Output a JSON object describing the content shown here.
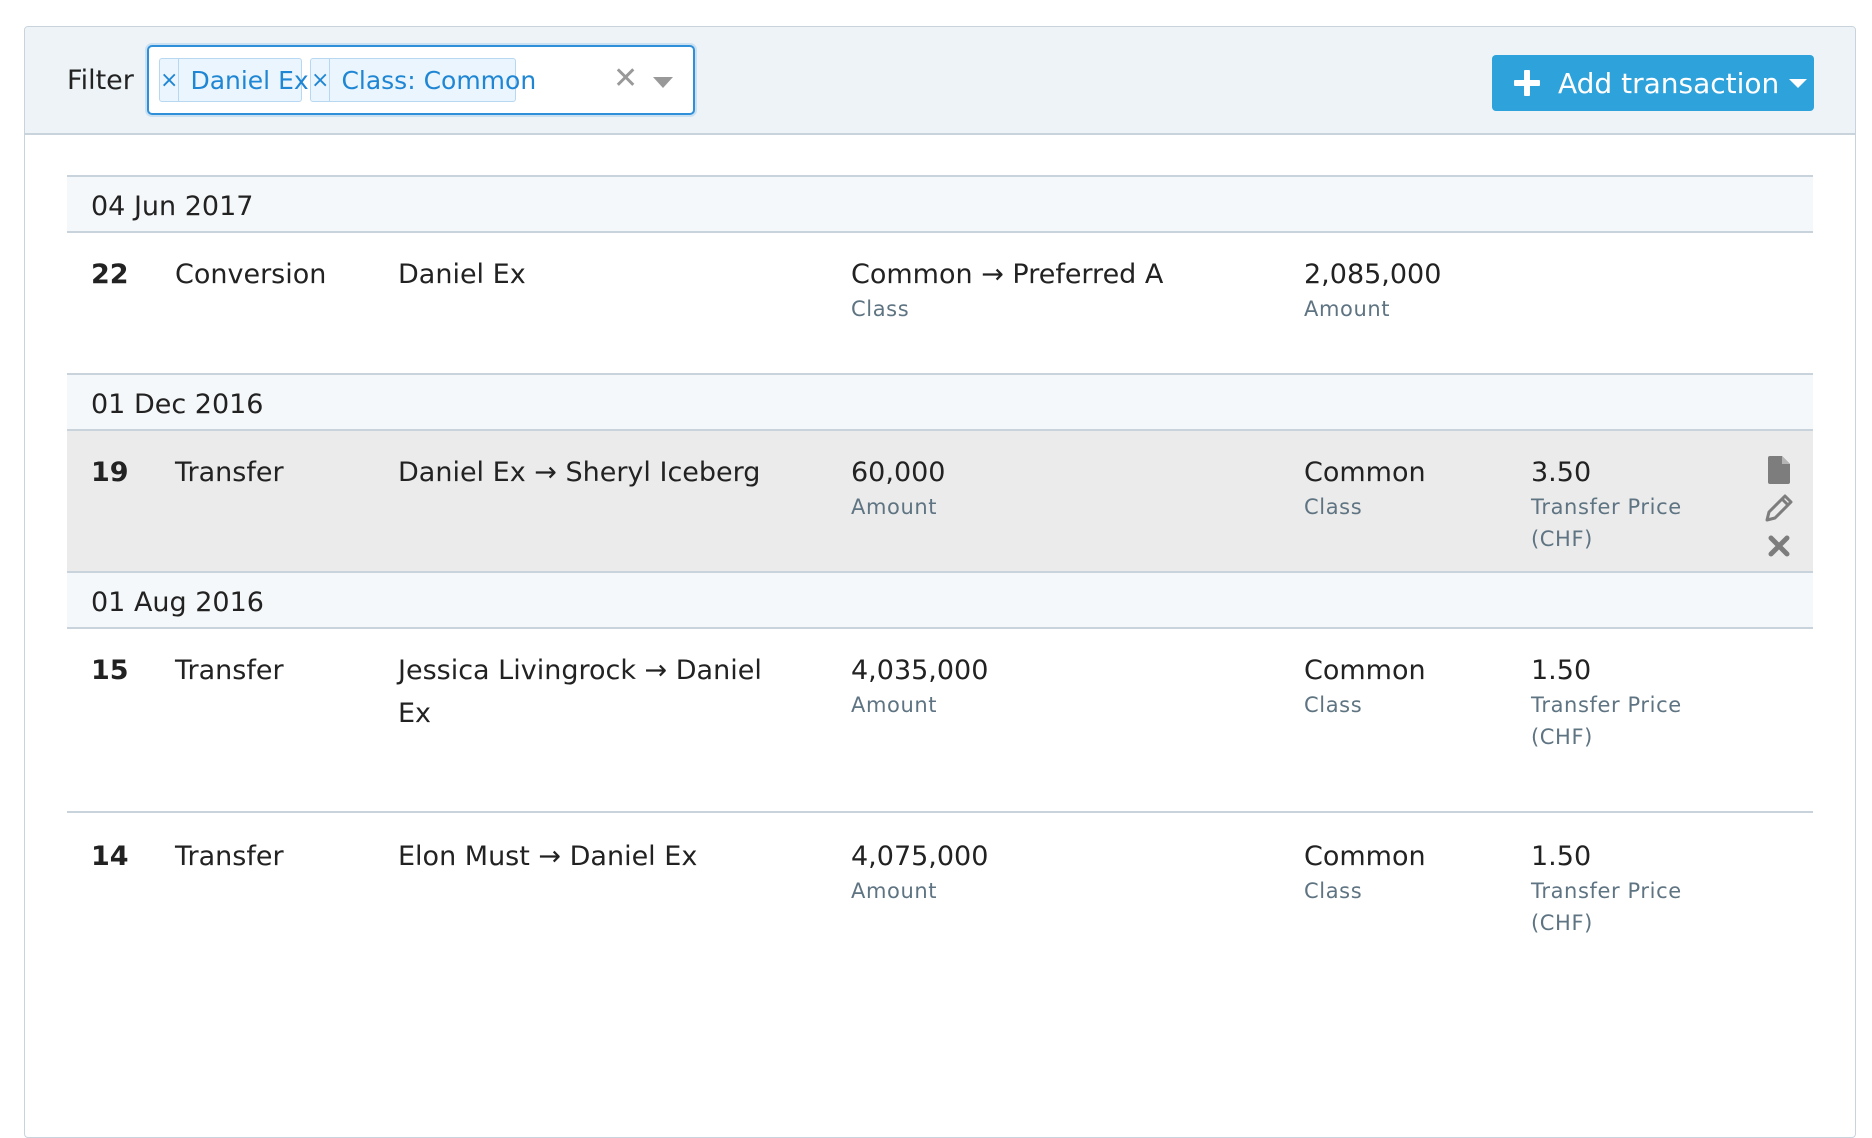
{
  "filter": {
    "label": "Filter",
    "chips": [
      "Daniel Ex",
      "Class: Common"
    ],
    "chip_remove_glyph": "×",
    "clear_glyph": "✕"
  },
  "toolbar": {
    "add_label": "Add transaction"
  },
  "groups": [
    {
      "date": "04 Jun 2017",
      "transactions": [
        {
          "number": "22",
          "type": "Conversion",
          "party": "Daniel Ex",
          "col_a_value": "Common → Preferred A",
          "col_a_label": "Class",
          "col_b_value": "2,085,000",
          "col_b_label": "Amount"
        }
      ]
    },
    {
      "date": "01 Dec 2016",
      "transactions": [
        {
          "number": "19",
          "type": "Transfer",
          "party": "Daniel Ex → Sheryl Iceberg",
          "col_a_value": "60,000",
          "col_a_label": "Amount",
          "col_b_value": "Common",
          "col_b_label": "Class",
          "col_c_value": "3.50",
          "col_c_label": "Transfer Price (CHF)"
        }
      ]
    },
    {
      "date": "01 Aug 2016",
      "transactions": [
        {
          "number": "15",
          "type": "Transfer",
          "party": "Jessica Livingrock → Daniel Ex",
          "col_a_value": "4,035,000",
          "col_a_label": "Amount",
          "col_b_value": "Common",
          "col_b_label": "Class",
          "col_c_value": "1.50",
          "col_c_label": "Transfer Price (CHF)"
        },
        {
          "number": "14",
          "type": "Transfer",
          "party": "Elon Must → Daniel Ex",
          "col_a_value": "4,075,000",
          "col_a_label": "Amount",
          "col_b_value": "Common",
          "col_b_label": "Class",
          "col_c_value": "1.50",
          "col_c_label": "Transfer Price (CHF)"
        }
      ]
    }
  ],
  "row_actions": [
    "document-icon",
    "pencil-icon",
    "delete-x-icon"
  ]
}
